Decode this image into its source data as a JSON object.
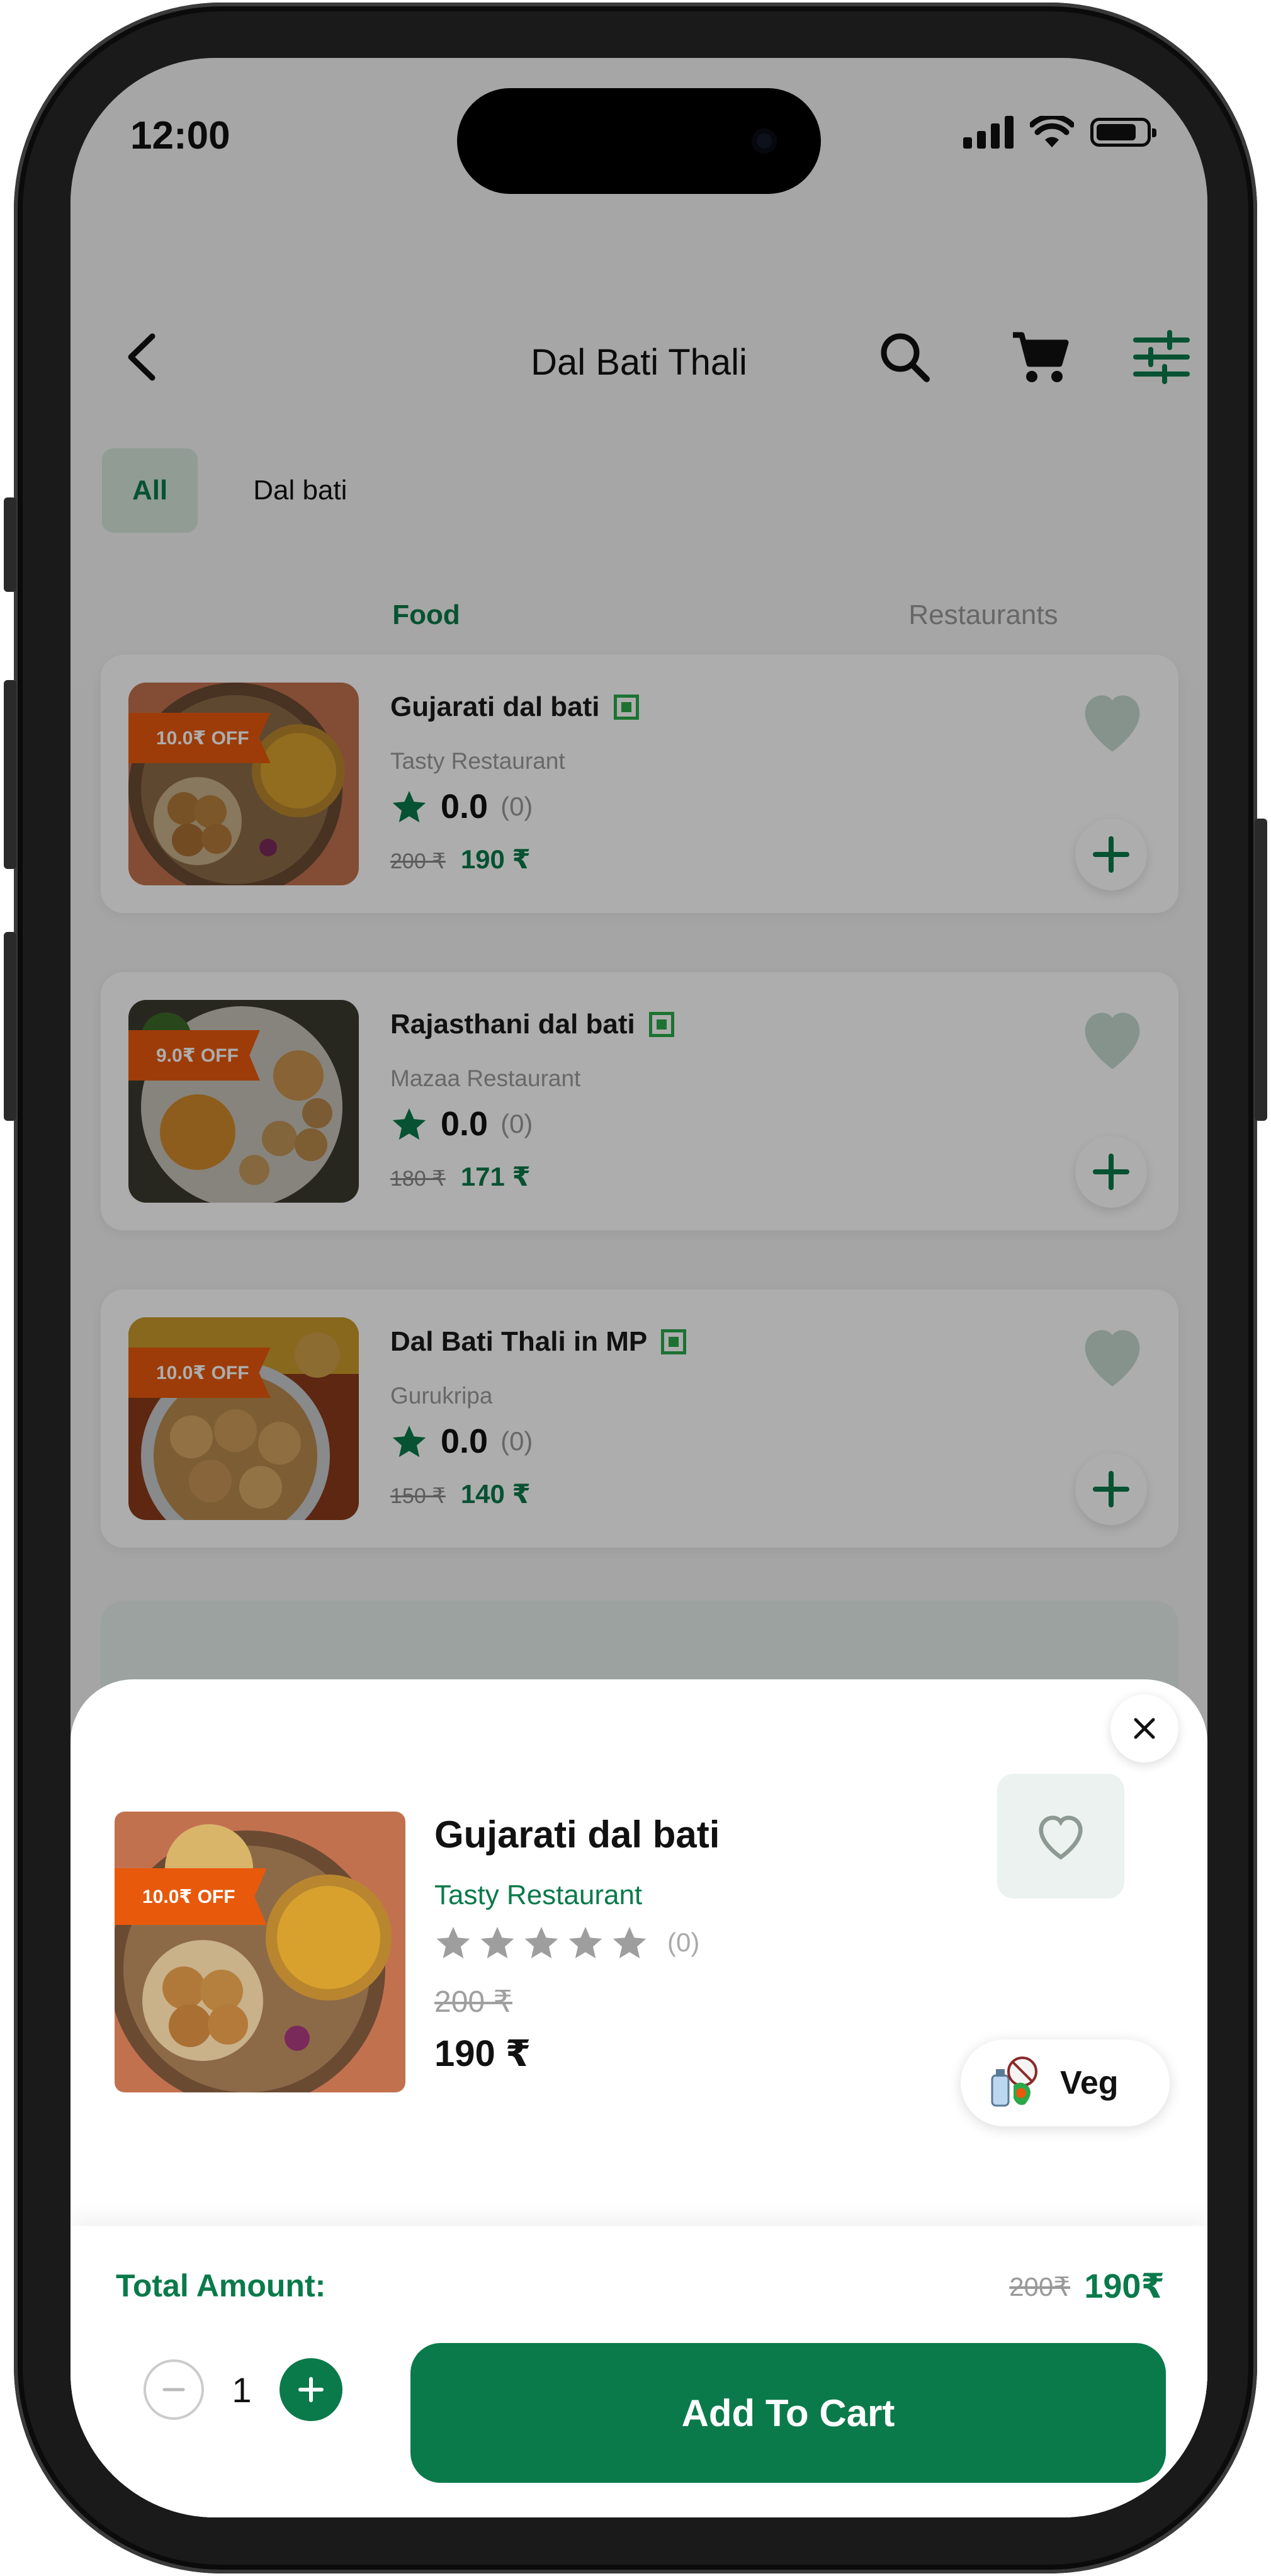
{
  "status_bar": {
    "time": "12:00"
  },
  "header": {
    "title": "Dal Bati Thali"
  },
  "chips": [
    {
      "label": "All",
      "active": true
    },
    {
      "label": "Dal bati",
      "active": false
    }
  ],
  "tabs": [
    {
      "label": "Food",
      "active": true
    },
    {
      "label": "Restaurants",
      "active": false
    }
  ],
  "items": [
    {
      "name": "Gujarati dal bati",
      "restaurant": "Tasty Restaurant",
      "rating": "0.0",
      "rating_count": "(0)",
      "old_price": "200 ₹",
      "price": "190 ₹",
      "discount": "10.0₹ OFF"
    },
    {
      "name": "Rajasthani dal bati",
      "restaurant": "Mazaa Restaurant",
      "rating": "0.0",
      "rating_count": "(0)",
      "old_price": "180 ₹",
      "price": "171 ₹",
      "discount": "9.0₹ OFF"
    },
    {
      "name": "Dal Bati Thali in MP",
      "restaurant": "Gurukripa",
      "rating": "0.0",
      "rating_count": "(0)",
      "old_price": "150 ₹",
      "price": "140 ₹",
      "discount": "10.0₹ OFF"
    }
  ],
  "sheet": {
    "discount": "10.0₹ OFF",
    "name": "Gujarati dal bati",
    "restaurant": "Tasty Restaurant",
    "rating_count": "(0)",
    "old_price": "200 ₹",
    "price": "190 ₹",
    "veg_label": "Veg",
    "total_label": "Total Amount:",
    "total_old": "200₹",
    "total_new": "190₹",
    "quantity": "1",
    "add_to_cart": "Add To Cart"
  },
  "colors": {
    "accent": "#0a7a4a",
    "badge": "#e8590c",
    "veg": "#2ba84a"
  }
}
